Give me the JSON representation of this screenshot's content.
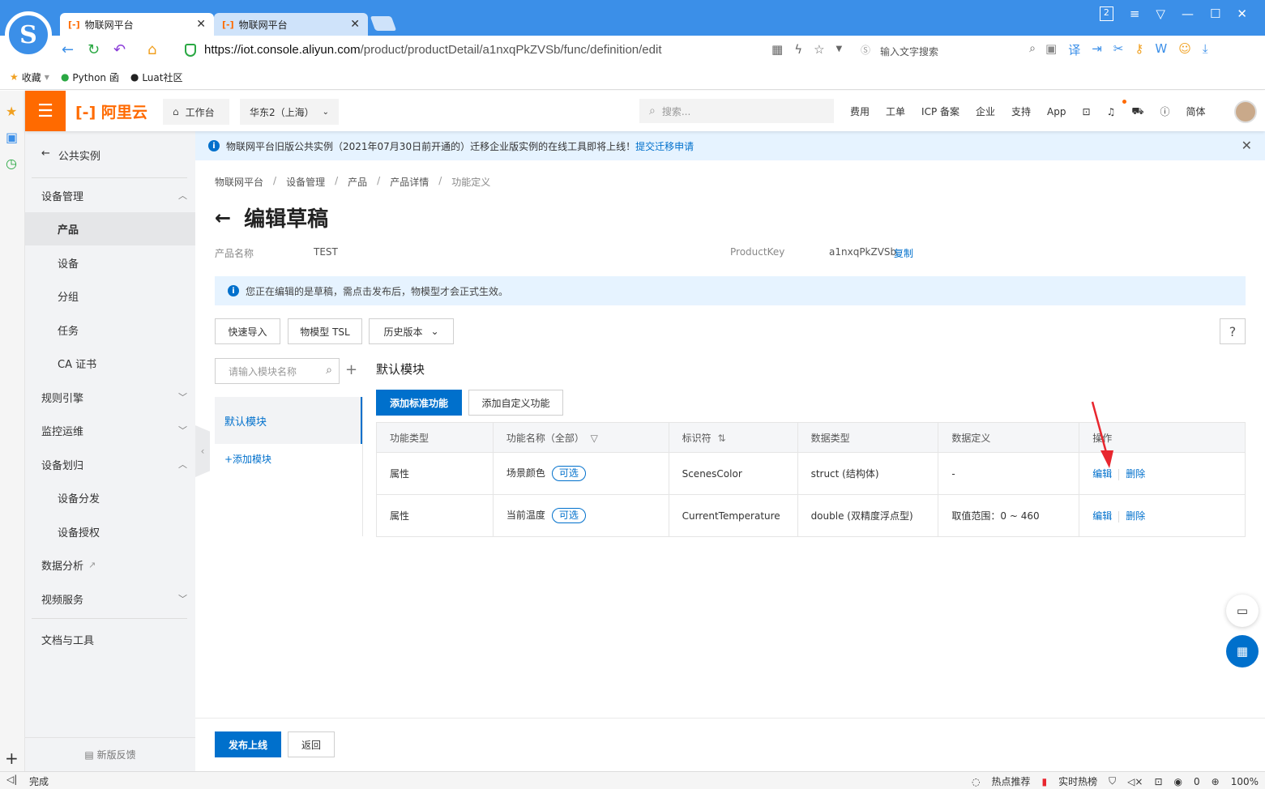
{
  "browser": {
    "tabs": [
      {
        "label": "物联网平台",
        "favicon": "[-]"
      },
      {
        "label": "物联网平台",
        "favicon": "[-]"
      }
    ],
    "window_badge": "2",
    "url_host": "https://iot.console.aliyun.com",
    "url_path": "/product/productDetail/a1nxqPkZVSb/func/definition/edit",
    "search_placeholder": "输入文字搜索",
    "bookmarks": [
      "收藏",
      "Python 函",
      "Luat社区"
    ],
    "status": "完成",
    "status_right": [
      "热点推荐",
      "实时热榜",
      "0",
      "100%"
    ]
  },
  "console": {
    "logo": "[-] 阿里云",
    "workbench": "工作台",
    "region": "华东2（上海）",
    "search_placeholder": "搜索...",
    "top_links": [
      "费用",
      "工单",
      "ICP 备案",
      "企业",
      "支持",
      "App"
    ],
    "lang": "简体"
  },
  "sidebar": {
    "back": "公共实例",
    "items": [
      {
        "label": "设备管理",
        "type": "group",
        "chevron": "up"
      },
      {
        "label": "产品",
        "type": "sub",
        "active": true
      },
      {
        "label": "设备",
        "type": "sub"
      },
      {
        "label": "分组",
        "type": "sub"
      },
      {
        "label": "任务",
        "type": "sub"
      },
      {
        "label": "CA 证书",
        "type": "sub"
      },
      {
        "label": "规则引擎",
        "type": "group",
        "chevron": "down"
      },
      {
        "label": "监控运维",
        "type": "group",
        "chevron": "down"
      },
      {
        "label": "设备划归",
        "type": "group",
        "chevron": "up"
      },
      {
        "label": "设备分发",
        "type": "sub"
      },
      {
        "label": "设备授权",
        "type": "sub"
      },
      {
        "label": "数据分析",
        "type": "group",
        "external": true
      },
      {
        "label": "视频服务",
        "type": "group",
        "chevron": "down"
      },
      {
        "label": "文档与工具",
        "type": "group"
      }
    ],
    "feedback": "新版反馈"
  },
  "announcement": {
    "text": "物联网平台旧版公共实例（2021年07月30日前开通的）迁移企业版实例的在线工具即将上线！",
    "link": "提交迁移申请"
  },
  "breadcrumb": [
    "物联网平台",
    "设备管理",
    "产品",
    "产品详情",
    "功能定义"
  ],
  "page": {
    "title": "编辑草稿",
    "product_name_label": "产品名称",
    "product_name": "TEST",
    "product_key_label": "ProductKey",
    "product_key": "a1nxqPkZVSb",
    "copy": "复制",
    "notice": "您正在编辑的是草稿，需点击发布后，物模型才会正式生效。",
    "toolbar": {
      "quick_import": "快速导入",
      "tsl": "物模型 TSL",
      "history": "历史版本",
      "help": "?"
    }
  },
  "modules": {
    "search_placeholder": "请输入模块名称",
    "active": "默认模块",
    "add": "+添加模块",
    "heading": "默认模块",
    "add_standard": "添加标准功能",
    "add_custom": "添加自定义功能"
  },
  "table": {
    "headers": [
      "功能类型",
      "功能名称（全部）",
      "标识符",
      "数据类型",
      "数据定义",
      "操作"
    ],
    "rows": [
      {
        "type": "属性",
        "name": "场景颜色",
        "tag": "可选",
        "identifier": "ScenesColor",
        "data_type": "struct (结构体)",
        "definition": "-",
        "edit": "编辑",
        "delete": "删除"
      },
      {
        "type": "属性",
        "name": "当前温度",
        "tag": "可选",
        "identifier": "CurrentTemperature",
        "data_type": "double (双精度浮点型)",
        "definition": "取值范围：0 ~ 460",
        "edit": "编辑",
        "delete": "删除"
      }
    ]
  },
  "footer": {
    "publish": "发布上线",
    "back": "返回"
  },
  "colors": {
    "brand": "#ff6a00",
    "primary": "#0070cc",
    "browser": "#3b8fe8"
  }
}
